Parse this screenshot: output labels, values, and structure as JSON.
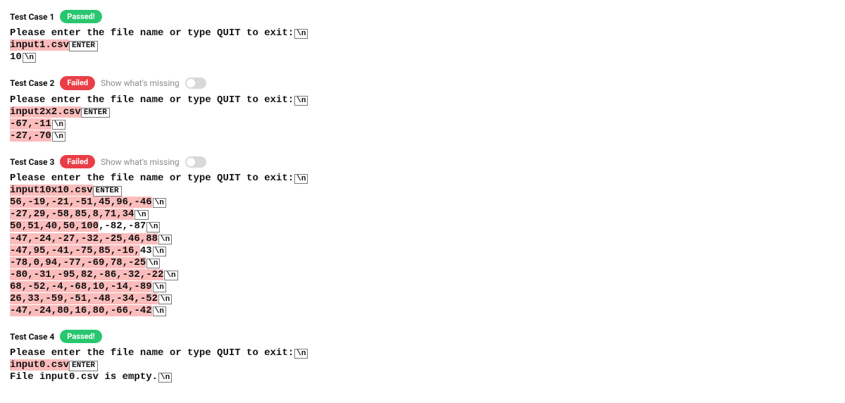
{
  "glyphs": {
    "newline": "\\n",
    "enter": "ENTER"
  },
  "toggle_label": "Show what's missing",
  "badge_passed": "Passed!",
  "badge_failed": "Failed",
  "cases": [
    {
      "title": "Test Case 1",
      "status": "passed",
      "lines": [
        {
          "segments": [
            {
              "text": "Please enter the file name or type QUIT to exit:"
            }
          ],
          "newline": true
        },
        {
          "segments": [
            {
              "text": "input1.csv",
              "hl": true
            }
          ],
          "enter": true
        },
        {
          "segments": [
            {
              "text": "10"
            }
          ],
          "newline": true
        }
      ]
    },
    {
      "title": "Test Case 2",
      "status": "failed",
      "show_toggle": true,
      "lines": [
        {
          "segments": [
            {
              "text": "Please enter the file name or type QUIT to exit:"
            }
          ],
          "newline": true
        },
        {
          "segments": [
            {
              "text": "input2x2.csv",
              "hl": true
            }
          ],
          "enter": true
        },
        {
          "segments": [
            {
              "text": "-67,-11",
              "hl": true
            }
          ],
          "newline": true
        },
        {
          "segments": [
            {
              "text": "-27,-70",
              "hl": true
            }
          ],
          "newline": true
        }
      ]
    },
    {
      "title": "Test Case 3",
      "status": "failed",
      "show_toggle": true,
      "lines": [
        {
          "segments": [
            {
              "text": "Please enter the file name or type QUIT to exit:"
            }
          ],
          "newline": true
        },
        {
          "segments": [
            {
              "text": "input10x10.csv",
              "hl": true
            }
          ],
          "enter": true
        },
        {
          "segments": [
            {
              "text": "56,-19,-21,-51,45,96,-46",
              "hl": true
            }
          ],
          "newline": true
        },
        {
          "segments": [
            {
              "text": "-27,29,-58,85,8,71,34",
              "hl": true
            }
          ],
          "newline": true
        },
        {
          "segments": [
            {
              "text": "50,51,40,50,100",
              "hl": true
            },
            {
              "text": ",-82,-87"
            }
          ],
          "newline": true
        },
        {
          "segments": [
            {
              "text": "-47,-24,-27,-32,-25,46,88",
              "hl": true
            }
          ],
          "newline": true
        },
        {
          "segments": [
            {
              "text": "-47,95,-41,-75,85,-16,",
              "hl": true
            },
            {
              "text": "43"
            }
          ],
          "newline": true
        },
        {
          "segments": [
            {
              "text": "-78,0,94,-77,-69,78,-25",
              "hl": true
            }
          ],
          "newline": true
        },
        {
          "segments": [
            {
              "text": "-80,-31,-95,82,-86,-32,-22",
              "hl": true
            }
          ],
          "newline": true
        },
        {
          "segments": [
            {
              "text": "68,-52,-4,-68,10,-14,-89",
              "hl": true
            }
          ],
          "newline": true
        },
        {
          "segments": [
            {
              "text": "26,33,-59,-51,-48,-34,-52",
              "hl": true
            }
          ],
          "newline": true
        },
        {
          "segments": [
            {
              "text": "-47,-24,80,16,80,-66,-42",
              "hl": true
            }
          ],
          "newline": true
        }
      ]
    },
    {
      "title": "Test Case 4",
      "status": "passed",
      "lines": [
        {
          "segments": [
            {
              "text": "Please enter the file name or type QUIT to exit:"
            }
          ],
          "newline": true
        },
        {
          "segments": [
            {
              "text": "input0.csv",
              "hl": true
            }
          ],
          "enter": true
        },
        {
          "segments": [
            {
              "text": "File input0.csv is empty."
            }
          ],
          "newline": true
        }
      ]
    }
  ]
}
